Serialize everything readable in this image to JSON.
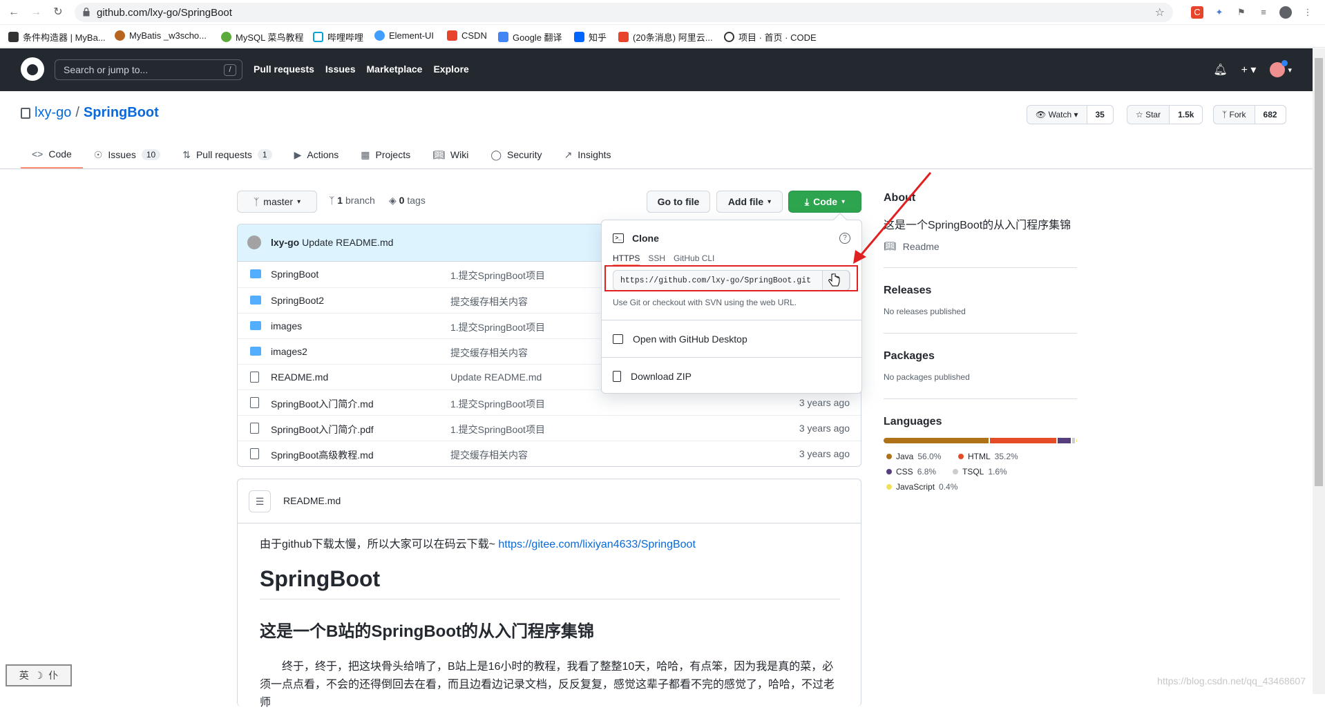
{
  "browser": {
    "url": "github.com/lxy-go/SpringBoot",
    "bookmarks": [
      "条件构造器 | MyBa...",
      "MyBatis _w3scho...",
      "MySQL 菜鸟教程",
      "哔哩哔哩",
      "Element-UI",
      "CSDN",
      "Google 翻译",
      "知乎",
      "(20条消息) 阿里云...",
      "项目 · 首页 · CODE"
    ]
  },
  "header": {
    "search_placeholder": "Search or jump to...",
    "search_shortcut": "/",
    "nav": [
      "Pull requests",
      "Issues",
      "Marketplace",
      "Explore"
    ]
  },
  "repo": {
    "owner": "lxy-go",
    "separator": "/",
    "name": "SpringBoot",
    "watch_label": "Watch",
    "watch_count": "35",
    "star_label": "Star",
    "star_count": "1.5k",
    "fork_label": "Fork",
    "fork_count": "682"
  },
  "tabs": [
    {
      "label": "Code",
      "count": ""
    },
    {
      "label": "Issues",
      "count": "10"
    },
    {
      "label": "Pull requests",
      "count": "1"
    },
    {
      "label": "Actions",
      "count": ""
    },
    {
      "label": "Projects",
      "count": ""
    },
    {
      "label": "Wiki",
      "count": ""
    },
    {
      "label": "Security",
      "count": ""
    },
    {
      "label": "Insights",
      "count": ""
    }
  ],
  "toolbar": {
    "branch": "master",
    "branch_count": "1",
    "branch_word": "branch",
    "tag_count": "0",
    "tag_word": "tags",
    "go_to_file": "Go to file",
    "add_file": "Add file",
    "code": "Code"
  },
  "commit": {
    "author": "lxy-go",
    "message": "Update README.md"
  },
  "files": [
    {
      "name": "SpringBoot",
      "type": "folder",
      "commit": "1.提交SpringBoot项目",
      "time": ""
    },
    {
      "name": "SpringBoot2",
      "type": "folder",
      "commit": "提交缓存相关内容",
      "time": ""
    },
    {
      "name": "images",
      "type": "folder",
      "commit": "1.提交SpringBoot项目",
      "time": ""
    },
    {
      "name": "images2",
      "type": "folder",
      "commit": "提交缓存相关内容",
      "time": ""
    },
    {
      "name": "README.md",
      "type": "file",
      "commit": "Update README.md",
      "time": ""
    },
    {
      "name": "SpringBoot入门简介.md",
      "type": "file",
      "commit": "1.提交SpringBoot项目",
      "time": "3 years ago"
    },
    {
      "name": "SpringBoot入门简介.pdf",
      "type": "file",
      "commit": "1.提交SpringBoot项目",
      "time": "3 years ago"
    },
    {
      "name": "SpringBoot高级教程.md",
      "type": "file",
      "commit": "提交缓存相关内容",
      "time": "3 years ago"
    }
  ],
  "clone": {
    "title": "Clone",
    "help": "?",
    "tabs": [
      "HTTPS",
      "SSH",
      "GitHub CLI"
    ],
    "url": "https://github.com/lxy-go/SpringBoot.git",
    "hint": "Use Git or checkout with SVN using the web URL.",
    "desktop": "Open with GitHub Desktop",
    "zip": "Download ZIP"
  },
  "readme": {
    "filename": "README.md",
    "intro": "由于github下载太慢，所以大家可以在码云下载~ ",
    "link": "https://gitee.com/lixiyan4633/SpringBoot",
    "h1": "SpringBoot",
    "h2": "这是一个B站的SpringBoot的从入门程序集锦",
    "paragraph": "终于，终于，把这块骨头给啃了，B站上是16小时的教程，我看了整整10天，哈哈，有点笨，因为我是真的菜，必须一点点看，不会的还得倒回去在看，而且边看边记录文档，反反复复，感觉这辈子都看不完的感觉了，哈哈，不过老师"
  },
  "about": {
    "title": "About",
    "description": "这是一个SpringBoot的从入门程序集锦",
    "readme_link": "Readme",
    "releases_title": "Releases",
    "releases_text": "No releases published",
    "packages_title": "Packages",
    "packages_text": "No packages published",
    "languages_title": "Languages",
    "languages": [
      {
        "name": "Java",
        "pct": "56.0%",
        "value": 56.0,
        "color": "#b07219"
      },
      {
        "name": "HTML",
        "pct": "35.2%",
        "value": 35.2,
        "color": "#e34c26"
      },
      {
        "name": "CSS",
        "pct": "6.8%",
        "value": 6.8,
        "color": "#563d7c"
      },
      {
        "name": "TSQL",
        "pct": "1.6%",
        "value": 1.6,
        "color": "#cccccc"
      },
      {
        "name": "JavaScript",
        "pct": "0.4%",
        "value": 0.4,
        "color": "#f1e05a"
      }
    ]
  },
  "ime": {
    "a": "英",
    "b": "☽",
    "c": "仆"
  },
  "watermark": "https://blog.csdn.net/qq_43468607"
}
